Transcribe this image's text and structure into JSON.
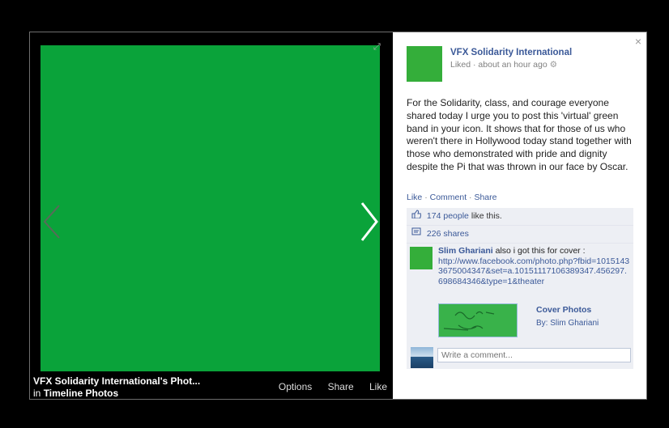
{
  "photo": {
    "color": "#0aa33a",
    "caption_title": "VFX Solidarity International's Phot...",
    "caption_in": "in",
    "caption_album": "Timeline Photos",
    "actions": [
      "Options",
      "Share",
      "Like"
    ]
  },
  "post": {
    "page_name": "VFX Solidarity International",
    "meta": "Liked · about an hour ago",
    "text": "For the Solidarity, class, and courage everyone shared today I urge you to post this 'virtual' green band in your icon. It shows that for those of us who weren't there in Hollywood today stand together with those who demonstrated with pride and dignity despite the Pi that was thrown in our face by Oscar.",
    "like_link": "Like",
    "comment_link": "Comment",
    "share_link": "Share",
    "separator": "·"
  },
  "ufi": {
    "likes_count": "174 people",
    "likes_suffix": "like this.",
    "shares": "226 shares"
  },
  "comment": {
    "author": "Slim Ghariani",
    "text": "also i got this for cover :",
    "link": "http://www.facebook.com/photo.php?fbid=10151433675004347&set=a.10151117106389347.456297.698684346&type=1&theater",
    "shared_title": "Cover Photos",
    "shared_by": "By: Slim Ghariani"
  },
  "composer": {
    "placeholder": "Write a comment..."
  }
}
